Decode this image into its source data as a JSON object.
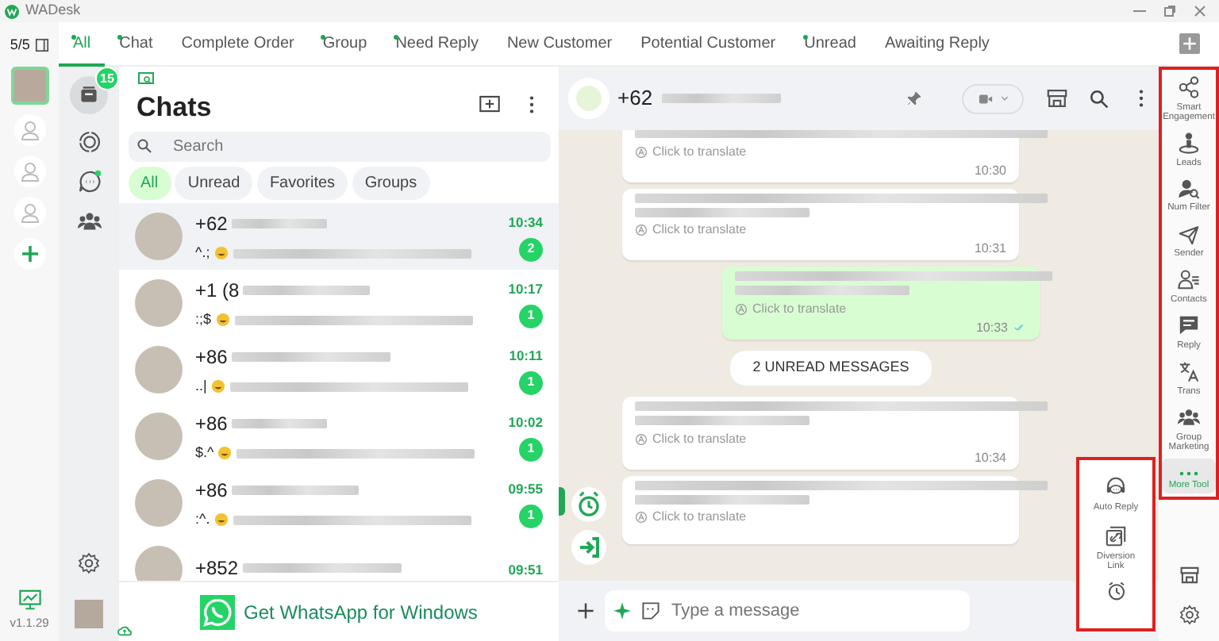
{
  "window": {
    "title": "WADesk"
  },
  "account_rail": {
    "counter": "5/5",
    "version": "v1.1.29"
  },
  "tabs": [
    {
      "label": "All",
      "dot": true,
      "selected": true
    },
    {
      "label": "Chat",
      "dot": true,
      "selected": false
    },
    {
      "label": "Complete Order",
      "dot": false,
      "selected": false
    },
    {
      "label": "Group",
      "dot": true,
      "selected": false
    },
    {
      "label": "Need Reply",
      "dot": true,
      "selected": false
    },
    {
      "label": "New Customer",
      "dot": false,
      "selected": false
    },
    {
      "label": "Potential Customer",
      "dot": false,
      "selected": false
    },
    {
      "label": "Unread",
      "dot": true,
      "selected": false
    },
    {
      "label": "Awaiting Reply",
      "dot": false,
      "selected": false
    }
  ],
  "nav_rail": {
    "badge": "15"
  },
  "chat_list": {
    "title": "Chats",
    "search": {
      "placeholder": "Search"
    },
    "filters": [
      {
        "label": "All",
        "selected": true
      },
      {
        "label": "Unread",
        "selected": false
      },
      {
        "label": "Favorites",
        "selected": false
      },
      {
        "label": "Groups",
        "selected": false
      }
    ],
    "chats": [
      {
        "name": "+62",
        "preview": "^.;",
        "time": "10:34",
        "unread": "2",
        "selected": true
      },
      {
        "name": "+1 (8",
        "preview": ":;$",
        "time": "10:17",
        "unread": "1",
        "selected": false
      },
      {
        "name": "+86",
        "preview": "..|",
        "time": "10:11",
        "unread": "1",
        "selected": false
      },
      {
        "name": "+86",
        "preview": "$.^",
        "time": "10:02",
        "unread": "1",
        "selected": false
      },
      {
        "name": "+86",
        "preview": ":^.",
        "time": "09:55",
        "unread": "1",
        "selected": false
      },
      {
        "name": "+852",
        "time": "09:51",
        "selected": false
      }
    ],
    "banner": "Get WhatsApp for Windows"
  },
  "conversation": {
    "name": "+62",
    "messages": [
      {
        "kind": "incoming",
        "translate": "Click to translate",
        "time": "10:30"
      },
      {
        "kind": "incoming",
        "translate": "Click to translate",
        "time": "10:31"
      },
      {
        "kind": "outgoing",
        "translate": "Click to translate",
        "time": "10:33"
      },
      {
        "kind": "divider",
        "text": "2 UNREAD MESSAGES"
      },
      {
        "kind": "incoming",
        "translate": "Click to translate",
        "time": "10:34"
      },
      {
        "kind": "incoming",
        "translate": "Click to translate"
      }
    ],
    "composer": {
      "placeholder": "Type a message"
    }
  },
  "floating_tools": [
    {
      "label": "Auto Reply",
      "kind": "headset"
    },
    {
      "label": "Diversion Link",
      "kind": "link"
    }
  ],
  "tools": [
    {
      "label": "Smart Engagement",
      "kind": "share",
      "selected": false
    },
    {
      "label": "Leads",
      "kind": "leads",
      "selected": false
    },
    {
      "label": "Num Filter",
      "kind": "filter",
      "selected": false
    },
    {
      "label": "Sender",
      "kind": "send",
      "selected": false
    },
    {
      "label": "Contacts",
      "kind": "contacts",
      "selected": false
    },
    {
      "label": "Reply",
      "kind": "reply",
      "selected": false
    },
    {
      "label": "Trans",
      "kind": "trans",
      "selected": false
    },
    {
      "label": "Group Marketing",
      "kind": "group",
      "selected": false
    },
    {
      "label": "More Tool",
      "kind": "more",
      "selected": true
    }
  ]
}
